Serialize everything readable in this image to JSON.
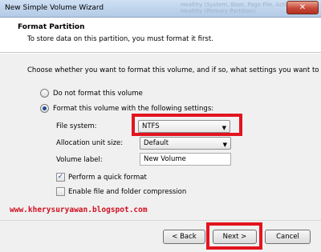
{
  "window": {
    "title": "New Simple Volume Wizard",
    "background_text": "Healthy (System, Boot, Page File, Active, Cr...",
    "background_text2": "Healthy (Primary Partition)",
    "close_label": "✕"
  },
  "header": {
    "title": "Format Partition",
    "subtitle": "To store data on this partition, you must format it first."
  },
  "body": {
    "intro": "Choose whether you want to format this volume, and if so, what settings you want to use.",
    "radio_no_format": "Do not format this volume",
    "radio_format": "Format this volume with the following settings:",
    "file_system_label": "File system:",
    "file_system_value": "NTFS",
    "allocation_label": "Allocation unit size:",
    "allocation_value": "Default",
    "volume_label_label": "Volume label:",
    "volume_label_value": "New Volume",
    "quick_format_label": "Perform a quick format",
    "quick_format_checked": true,
    "compression_label": "Enable file and folder compression",
    "compression_checked": false
  },
  "watermark": "www.kherysuryawan.blogspot.com",
  "footer": {
    "back_label": "< Back",
    "next_label": "Next >",
    "cancel_label": "Cancel"
  },
  "colors": {
    "highlight": "#e2141f",
    "watermark": "#d01020"
  }
}
